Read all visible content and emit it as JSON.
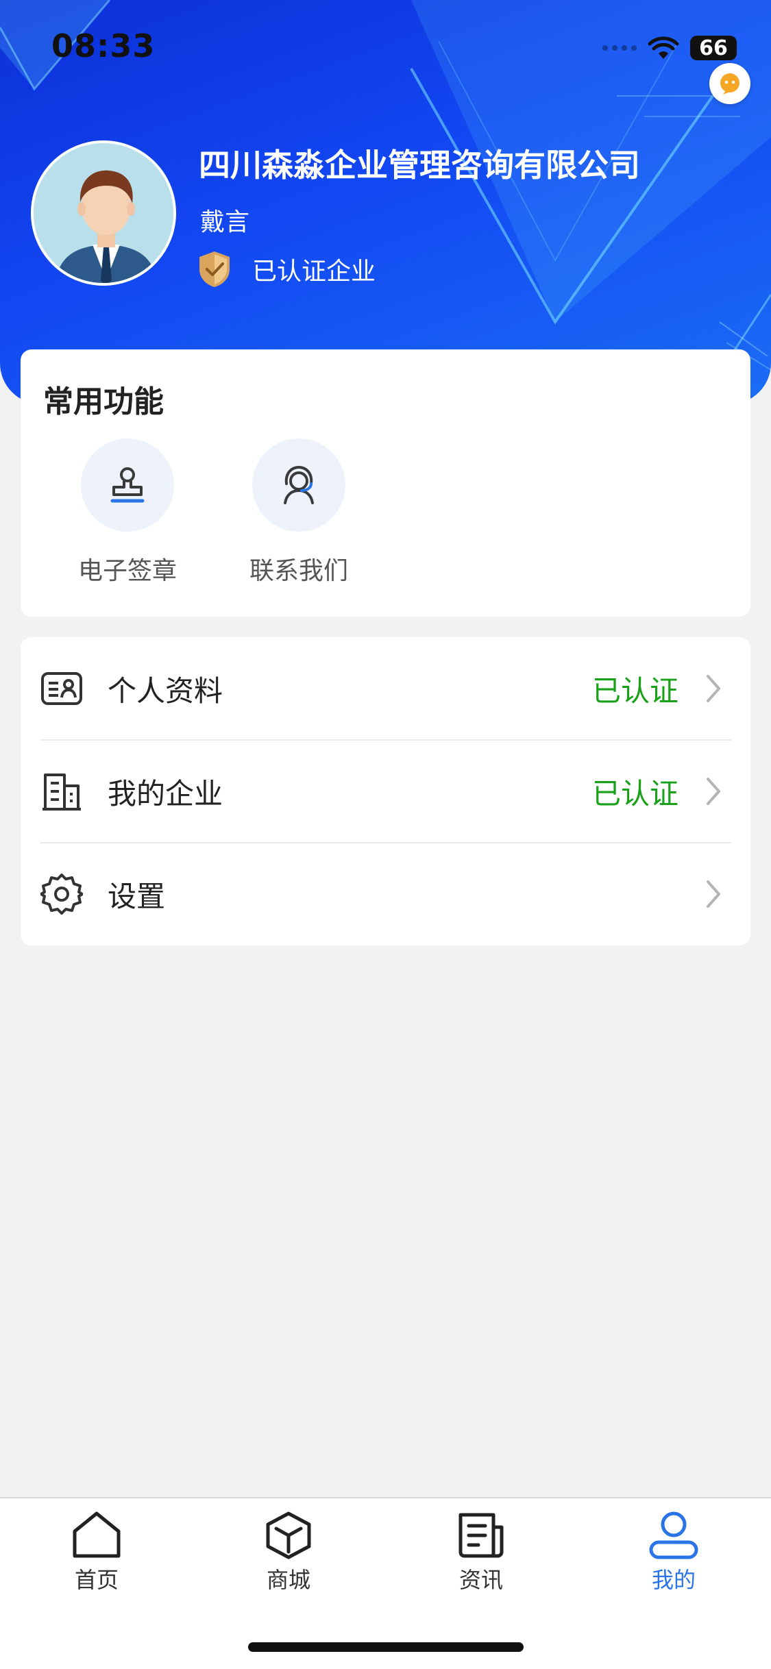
{
  "status_bar": {
    "time": "08:33",
    "battery": "66"
  },
  "header": {
    "company_name": "四川森淼企业管理咨询有限公司",
    "user_name": "戴言",
    "cert_badge": "已认证企业"
  },
  "functions": {
    "title": "常用功能",
    "items": [
      {
        "label": "电子签章",
        "icon": "stamp-icon"
      },
      {
        "label": "联系我们",
        "icon": "customer-service-icon"
      }
    ]
  },
  "menu": {
    "items": [
      {
        "label": "个人资料",
        "status": "已认证",
        "icon": "id-card-icon"
      },
      {
        "label": "我的企业",
        "status": "已认证",
        "icon": "building-icon"
      },
      {
        "label": "设置",
        "status": "",
        "icon": "gear-icon"
      }
    ]
  },
  "tabbar": {
    "items": [
      {
        "label": "首页",
        "icon": "home-icon",
        "active": false
      },
      {
        "label": "商城",
        "icon": "cube-icon",
        "active": false
      },
      {
        "label": "资讯",
        "icon": "news-icon",
        "active": false
      },
      {
        "label": "我的",
        "icon": "user-icon",
        "active": true
      }
    ]
  },
  "colors": {
    "header_blue": "#1247f2",
    "verified_green": "#1aa11a",
    "active_tab": "#2a74e8"
  }
}
